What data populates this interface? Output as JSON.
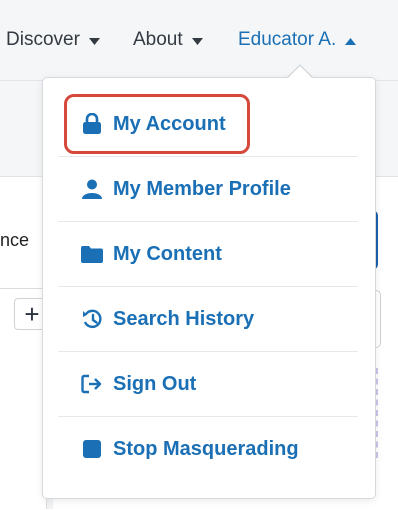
{
  "nav": {
    "discover_label": "Discover",
    "about_label": "About",
    "user_label": "Educator A.",
    "accent_color": "#1a6fb5"
  },
  "background": {
    "partial_text": "nce",
    "add_button_label": "+"
  },
  "menu": {
    "items": [
      {
        "label": "My Account",
        "icon": "lock-icon"
      },
      {
        "label": "My Member Profile",
        "icon": "user-icon"
      },
      {
        "label": "My Content",
        "icon": "folder-icon"
      },
      {
        "label": "Search History",
        "icon": "history-icon"
      },
      {
        "label": "Sign Out",
        "icon": "sign-out-icon"
      },
      {
        "label": "Stop Masquerading",
        "icon": "stop-icon"
      }
    ],
    "highlight_color": "#d5483b"
  }
}
